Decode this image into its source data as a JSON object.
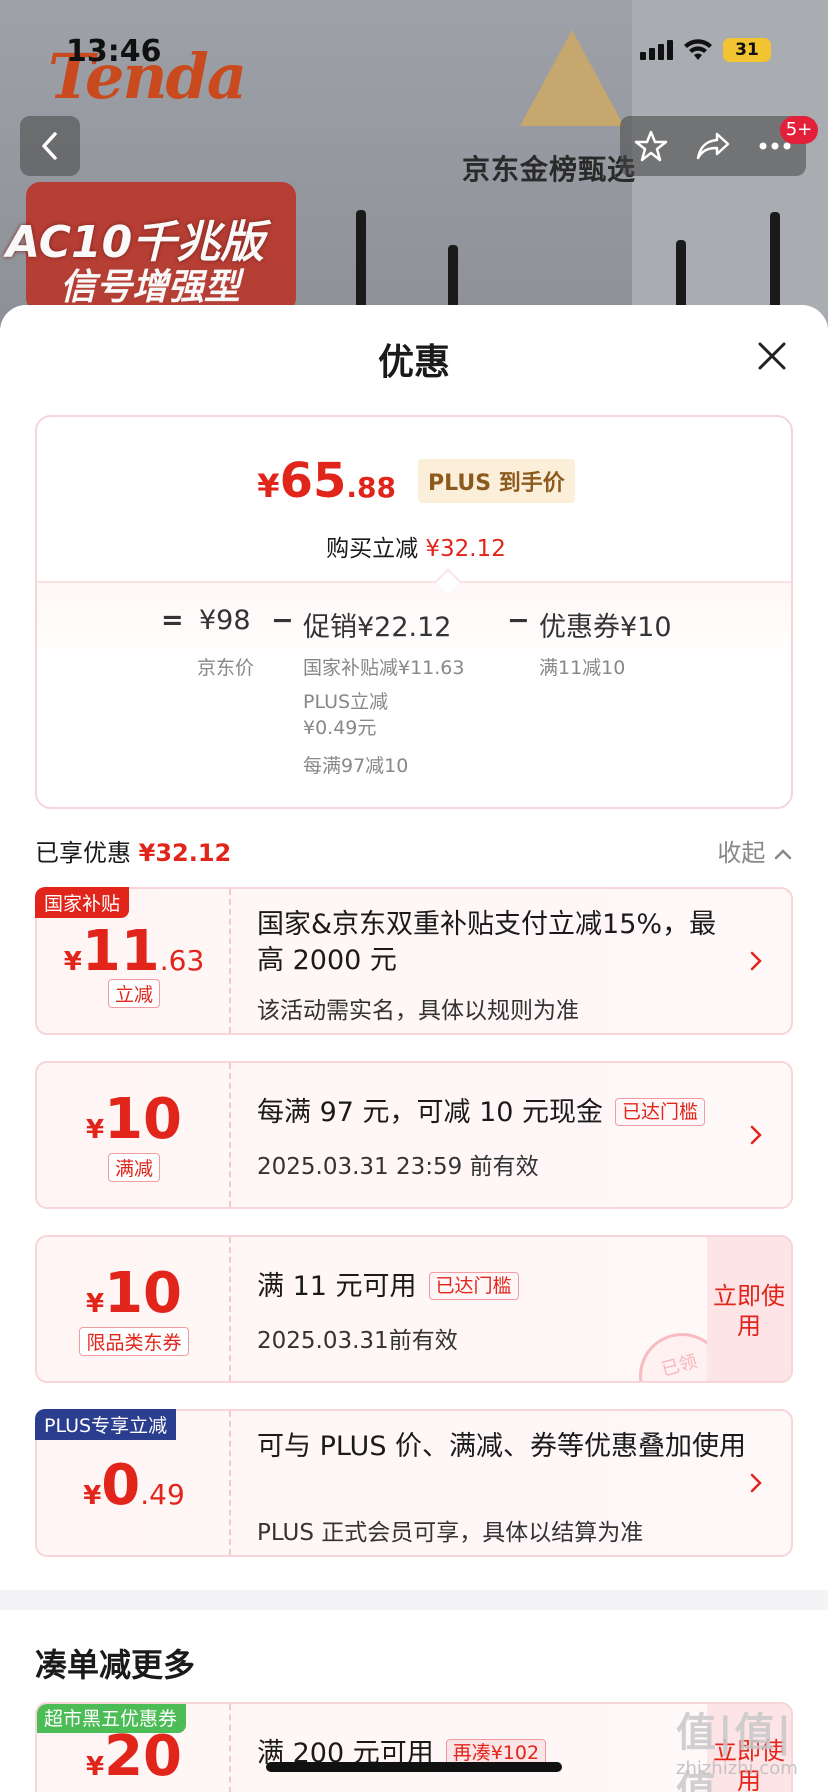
{
  "status": {
    "time": "13:46",
    "battery": "31"
  },
  "background": {
    "brand": "Tenda",
    "model_line1": "AC10千兆版",
    "model_line2": "信号增强型",
    "award": "京东金榜甄选",
    "badge": "5+"
  },
  "sheet": {
    "title": "优惠"
  },
  "summary": {
    "yen": "¥",
    "price_int": "65",
    "price_dec": ".88",
    "plus_tag": "PLUS 到手价",
    "buy_reduce_label": "购买立减",
    "buy_reduce_value": "¥32.12",
    "eq": "=",
    "jd_price": "¥98",
    "jd_price_label": "京东价",
    "minus1": "−",
    "promo": "促销¥22.12",
    "promo_detail1": "国家补贴减¥11.63",
    "promo_detail2a": "PLUS立减",
    "promo_detail2b": "¥0.49元",
    "promo_detail3": "每满97减10",
    "minus2": "−",
    "coupon": "优惠券¥10",
    "coupon_detail": "满11减10"
  },
  "enjoyed": {
    "label": "已享优惠",
    "value": "¥32.12",
    "collapse": "收起"
  },
  "coupons": [
    {
      "tag": "国家补贴",
      "tag_color": "#e1251b",
      "yen": "¥",
      "int": "11",
      "dec": ".63",
      "kind": "立减",
      "title": "国家&京东双重补贴支付立减15%，最高 2000 元",
      "sub": "该活动需实名，具体以规则为准"
    },
    {
      "yen": "¥",
      "int": "10",
      "dec": "",
      "kind": "满减",
      "title": "每满 97 元，可减 10 元现金",
      "reached": "已达门槛",
      "sub": "2025.03.31 23:59 前有效"
    },
    {
      "yen": "¥",
      "int": "10",
      "dec": "",
      "kind": "限品类东券",
      "title": "满 11 元可用",
      "reached": "已达门槛",
      "sub": "2025.03.31前有效",
      "use_now": "立即使用",
      "stamp": "已领"
    },
    {
      "tag": "PLUS专享立减",
      "tag_color": "#2a3d8f",
      "yen": "¥",
      "int": "0",
      "dec": ".49",
      "title": "可与 PLUS 价、满减、券等优惠叠加使用",
      "sub": "PLUS 正式会员可享，具体以结算为准"
    }
  ],
  "more": {
    "title": "凑单减更多",
    "coupon": {
      "tag": "超市黑五优惠券",
      "tag_color": "#4cbc57",
      "yen": "¥",
      "int": "20",
      "title": "满 200 元可用",
      "extra": "再凑¥102",
      "use_now": "立即使用"
    }
  },
  "watermark": {
    "logo": "值|值|值",
    "site": "zhizhizhi.com"
  }
}
